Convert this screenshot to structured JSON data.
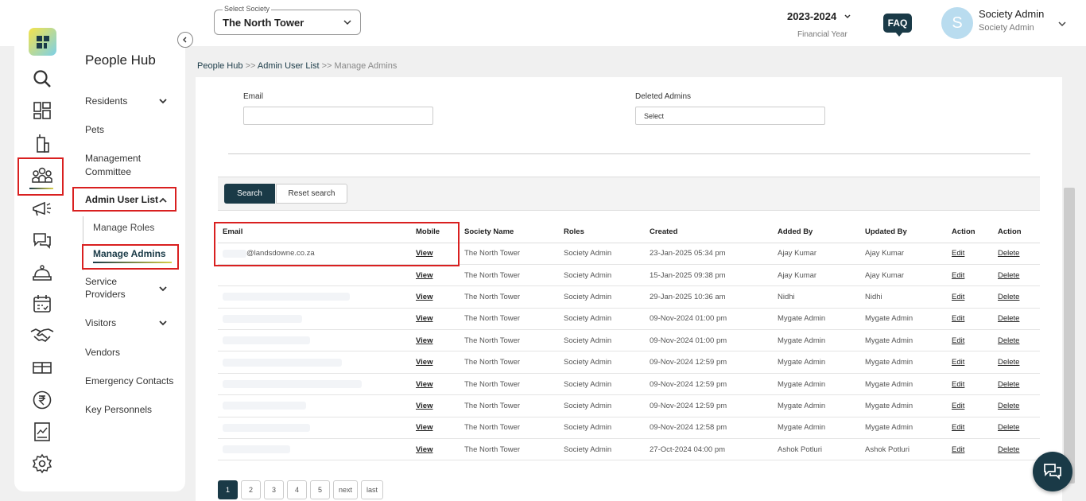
{
  "header": {
    "society_label": "Select Society",
    "society_value": "The North Tower",
    "financial_year": "2023-2024",
    "financial_year_label": "Financial Year",
    "faq_label": "FAQ",
    "avatar_initial": "S",
    "user_name": "Society Admin",
    "user_role": "Society Admin"
  },
  "sidebar": {
    "title": "People Hub",
    "items": {
      "residents": "Residents",
      "pets": "Pets",
      "management_committee": "Management Committee",
      "admin_user_list": "Admin User List",
      "manage_roles": "Manage Roles",
      "manage_admins": "Manage Admins",
      "service_providers": "Service Providers",
      "visitors": "Visitors",
      "vendors": "Vendors",
      "emergency_contacts": "Emergency Contacts",
      "key_personnels": "Key Personnels"
    }
  },
  "breadcrumb": {
    "people_hub": "People Hub",
    "sep1": ">>",
    "admin_user_list": "Admin User List",
    "sep2": ">>",
    "manage_admins": "Manage Admins"
  },
  "filters": {
    "email_label": "Email",
    "email_value": "",
    "deleted_label": "Deleted Admins",
    "deleted_value": "Select",
    "search_button": "Search",
    "reset_button": "Reset search"
  },
  "table": {
    "headers": [
      "Email",
      "Mobile",
      "Society Name",
      "Roles",
      "Created",
      "Added By",
      "Updated By",
      "Action",
      "Action"
    ],
    "rows": [
      {
        "email": "@landsdowne.co.za",
        "mobile": "View",
        "society": "The North Tower",
        "role": "Society Admin",
        "created": "23-Jan-2025 05:34 pm",
        "added_by": "Ajay Kumar",
        "updated_by": "Ajay Kumar",
        "edit": "Edit",
        "delete": "Delete"
      },
      {
        "email": "",
        "mobile": "View",
        "society": "The North Tower",
        "role": "Society Admin",
        "created": "15-Jan-2025 09:38 pm",
        "added_by": "Ajay Kumar",
        "updated_by": "Ajay Kumar",
        "edit": "Edit",
        "delete": "Delete"
      },
      {
        "email": "",
        "mobile": "View",
        "society": "The North Tower",
        "role": "Society Admin",
        "created": "29-Jan-2025 10:36 am",
        "added_by": "Nidhi",
        "updated_by": "Nidhi",
        "edit": "Edit",
        "delete": "Delete"
      },
      {
        "email": "",
        "mobile": "View",
        "society": "The North Tower",
        "role": "Society Admin",
        "created": "09-Nov-2024 01:00 pm",
        "added_by": "Mygate Admin",
        "updated_by": "Mygate Admin",
        "edit": "Edit",
        "delete": "Delete"
      },
      {
        "email": "",
        "mobile": "View",
        "society": "The North Tower",
        "role": "Society Admin",
        "created": "09-Nov-2024 01:00 pm",
        "added_by": "Mygate Admin",
        "updated_by": "Mygate Admin",
        "edit": "Edit",
        "delete": "Delete"
      },
      {
        "email": "",
        "mobile": "View",
        "society": "The North Tower",
        "role": "Society Admin",
        "created": "09-Nov-2024 12:59 pm",
        "added_by": "Mygate Admin",
        "updated_by": "Mygate Admin",
        "edit": "Edit",
        "delete": "Delete"
      },
      {
        "email": "",
        "mobile": "View",
        "society": "The North Tower",
        "role": "Society Admin",
        "created": "09-Nov-2024 12:59 pm",
        "added_by": "Mygate Admin",
        "updated_by": "Mygate Admin",
        "edit": "Edit",
        "delete": "Delete"
      },
      {
        "email": "",
        "mobile": "View",
        "society": "The North Tower",
        "role": "Society Admin",
        "created": "09-Nov-2024 12:59 pm",
        "added_by": "Mygate Admin",
        "updated_by": "Mygate Admin",
        "edit": "Edit",
        "delete": "Delete"
      },
      {
        "email": "",
        "mobile": "View",
        "society": "The North Tower",
        "role": "Society Admin",
        "created": "09-Nov-2024 12:58 pm",
        "added_by": "Mygate Admin",
        "updated_by": "Mygate Admin",
        "edit": "Edit",
        "delete": "Delete"
      },
      {
        "email": "",
        "mobile": "View",
        "society": "The North Tower",
        "role": "Society Admin",
        "created": "27-Oct-2024 04:00 pm",
        "added_by": "Ashok Potluri",
        "updated_by": "Ashok Potluri",
        "edit": "Edit",
        "delete": "Delete"
      }
    ]
  },
  "pagination": [
    "1",
    "2",
    "3",
    "4",
    "5",
    "next",
    "last"
  ],
  "colors": {
    "accent": "#1a3a47",
    "highlight": "#d92020"
  },
  "rail_icons": [
    "app-logo-icon",
    "search-icon",
    "dashboard-icon",
    "building-icon",
    "people-icon",
    "announcement-icon",
    "chat-icon",
    "helpdesk-icon",
    "calendar-icon",
    "handshake-icon",
    "amenity-icon",
    "rupee-icon",
    "report-icon",
    "settings-icon"
  ]
}
